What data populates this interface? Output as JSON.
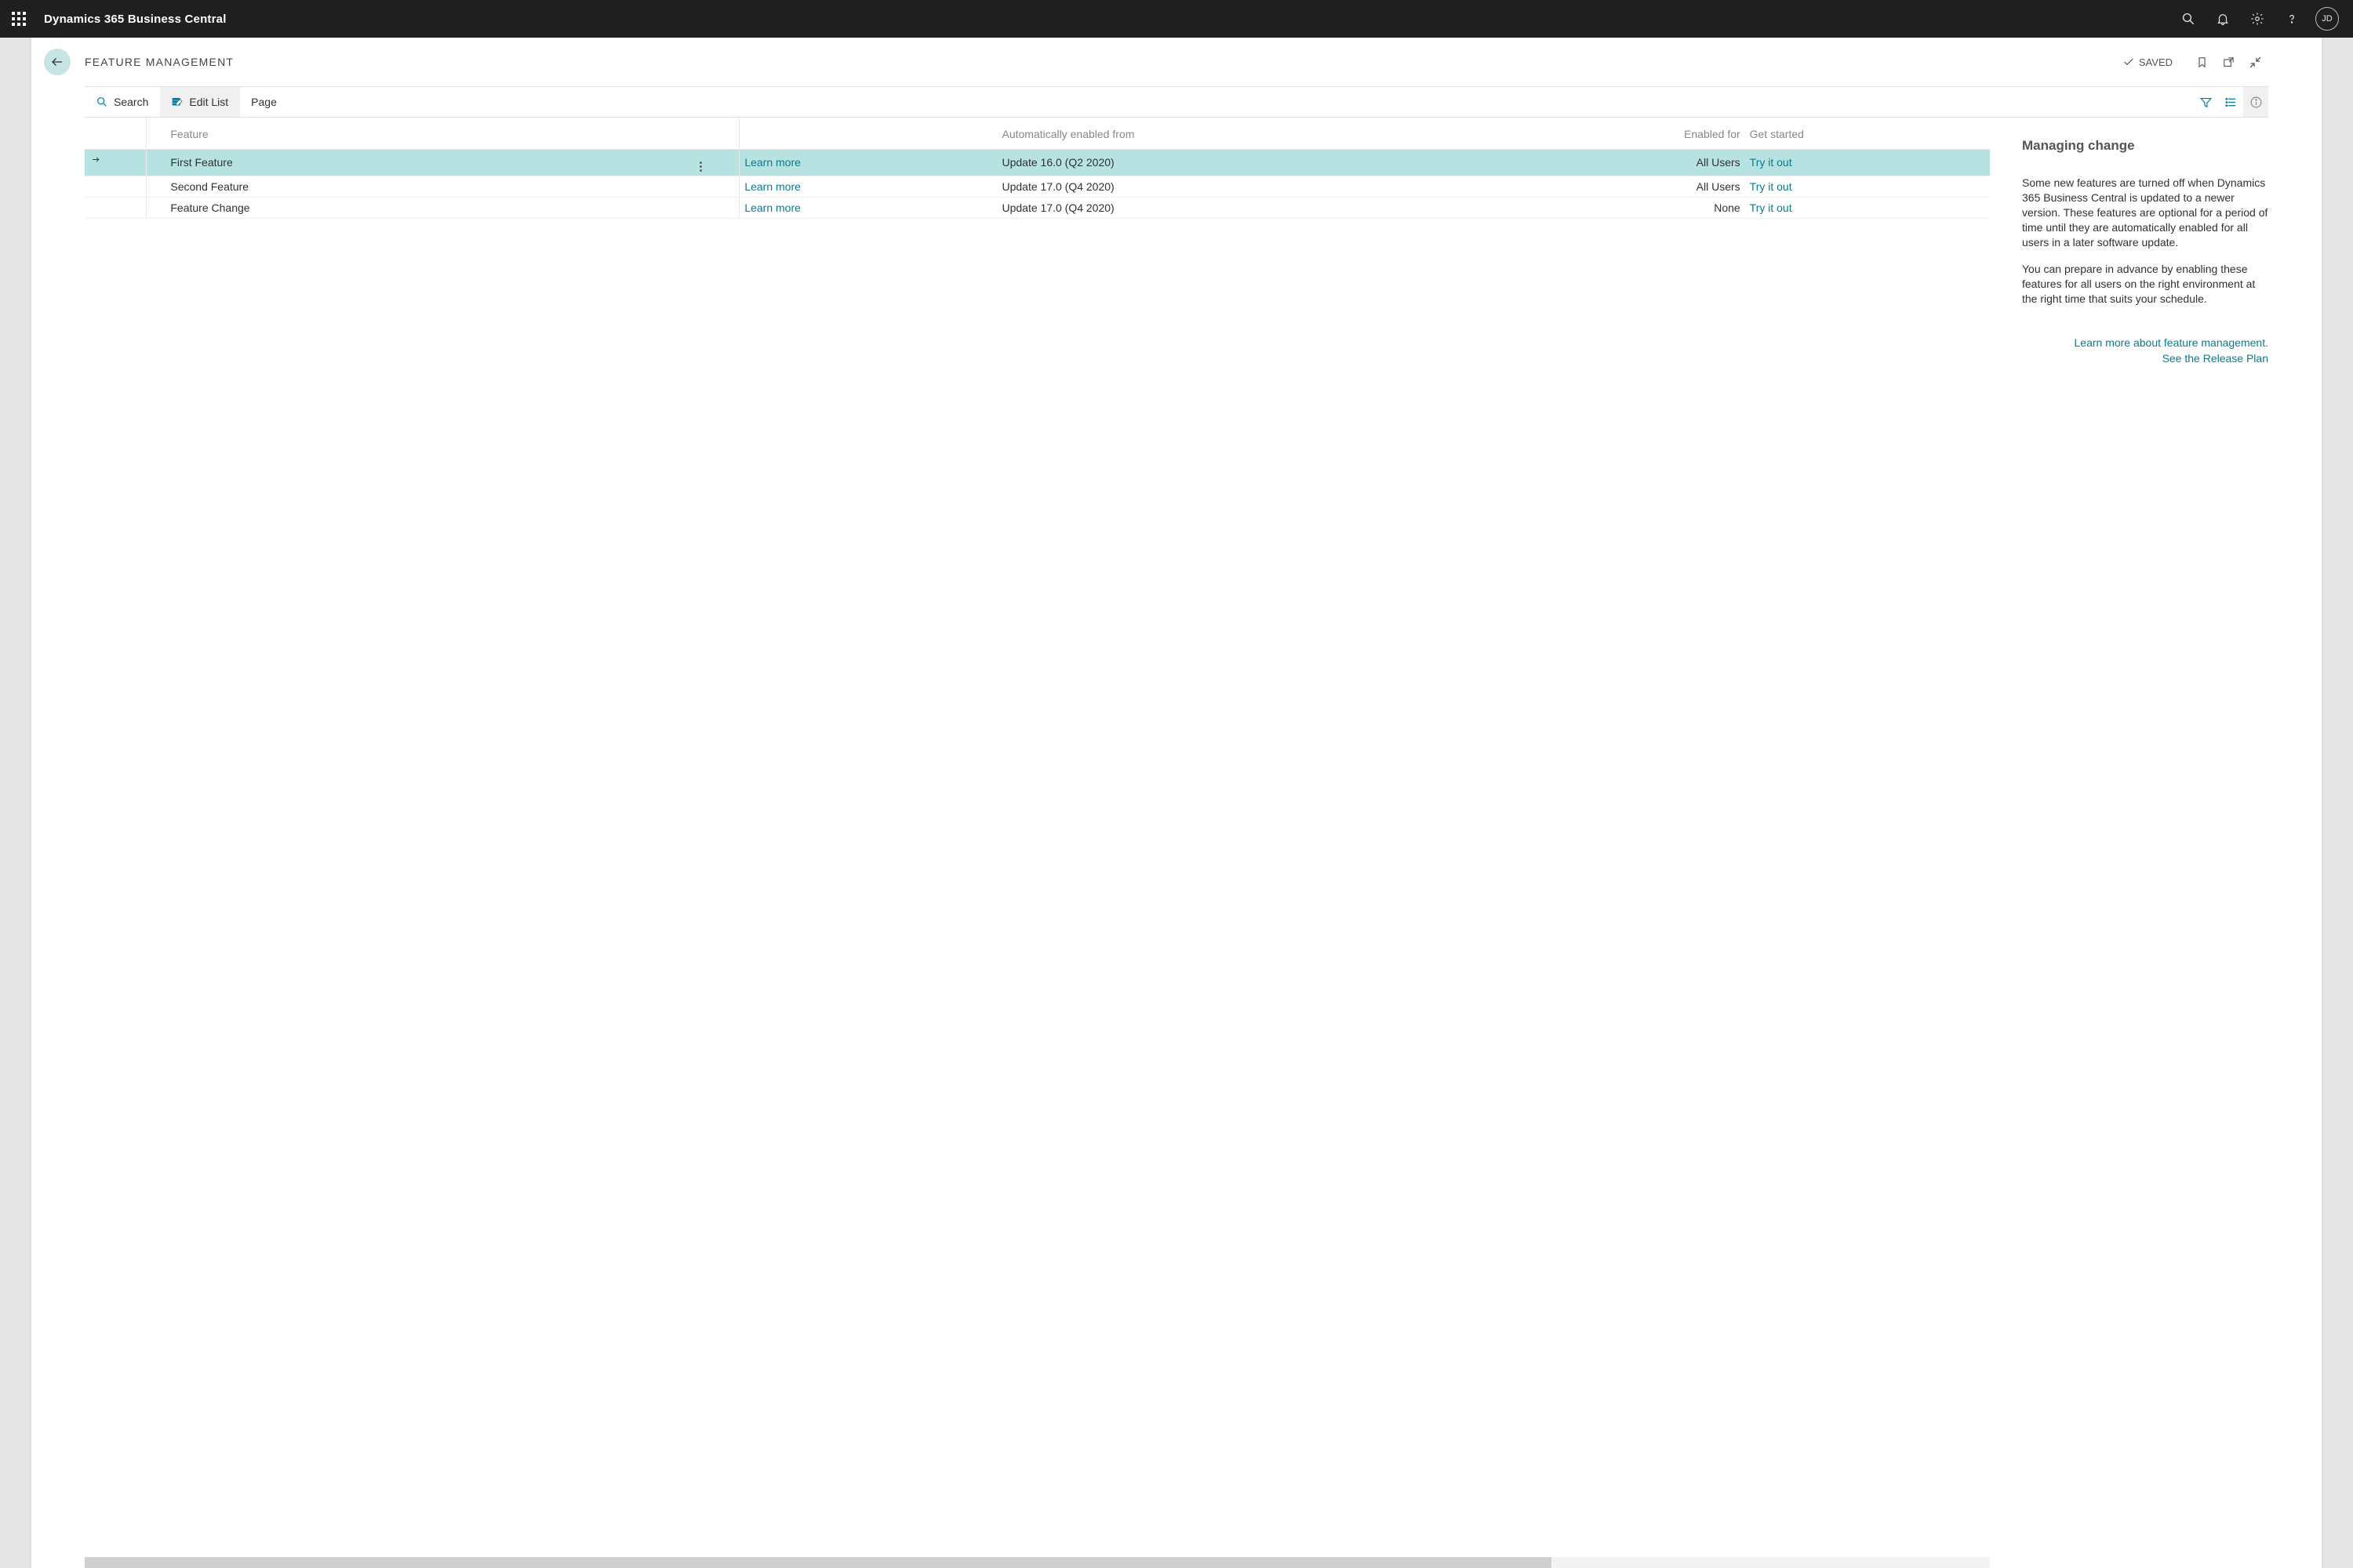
{
  "appbar": {
    "title": "Dynamics 365 Business Central",
    "avatar_initials": "JD"
  },
  "page": {
    "title": "FEATURE MANAGEMENT",
    "saved_label": "SAVED"
  },
  "toolbar": {
    "search_label": "Search",
    "edit_list_label": "Edit List",
    "page_label": "Page"
  },
  "columns": {
    "feature": "Feature",
    "auto_enabled": "Automatically enabled from",
    "enabled_for": "Enabled for",
    "get_started": "Get started"
  },
  "rows": [
    {
      "feature": "First Feature",
      "learn_more": "Learn more",
      "auto_enabled": "Update 16.0 (Q2 2020)",
      "enabled_for": "All Users",
      "get_started": "Try it out",
      "selected": true
    },
    {
      "feature": "Second Feature",
      "learn_more": "Learn more",
      "auto_enabled": "Update 17.0 (Q4 2020)",
      "enabled_for": "All Users",
      "get_started": "Try it out",
      "selected": false
    },
    {
      "feature": "Feature Change",
      "learn_more": "Learn more",
      "auto_enabled": "Update 17.0 (Q4 2020)",
      "enabled_for": "None",
      "get_started": "Try it out",
      "selected": false
    }
  ],
  "sidepanel": {
    "title": "Managing change",
    "paragraph1": "Some new features are turned off when Dynamics 365 Business Central is updated to a newer version. These features are optional for a period of time until they are automatically enabled for all users in a later software update.",
    "paragraph2": "You can prepare in advance by enabling these features for all users on the right environment at the right time that suits your schedule.",
    "link1": "Learn more about feature management.",
    "link2": "See the Release Plan"
  }
}
